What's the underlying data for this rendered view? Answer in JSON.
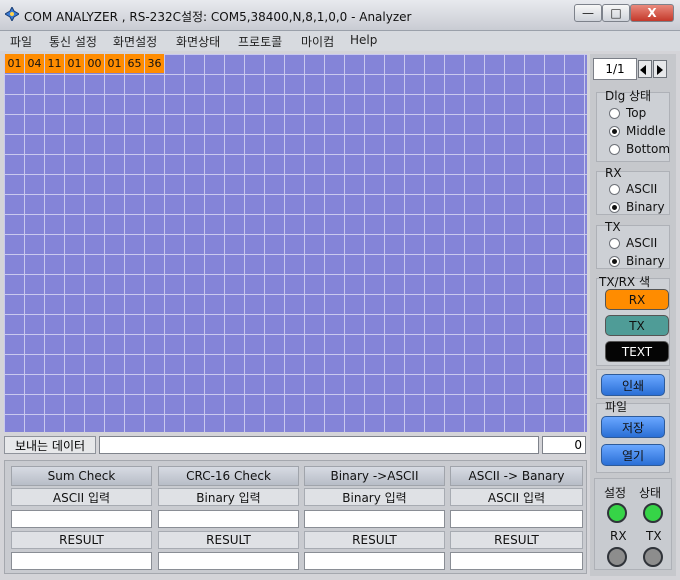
{
  "window": {
    "title": "COM ANALYZER , RS-232C설정: COM5,38400,N,8,1,0,0  - Analyzer",
    "buttons": {
      "minimize": "—",
      "maximize": "□",
      "close": "X"
    }
  },
  "menu": [
    "파일",
    "통신 설정",
    "화면설정",
    "화면상태",
    "프로토콜",
    "마이컴",
    "Help"
  ],
  "grid": {
    "cells": [
      "01",
      "04",
      "11",
      "01",
      "00",
      "01",
      "65",
      "36"
    ]
  },
  "send": {
    "label": "보내는 데이터",
    "value": "",
    "count": "0"
  },
  "tools": {
    "checks": [
      "Sum Check",
      "CRC-16 Check",
      "Binary ->ASCII",
      "ASCII -> Banary"
    ],
    "input_labels": [
      "ASCII 입력",
      "Binary 입력",
      "Binary 입력",
      "ASCII 입력"
    ],
    "results": [
      "RESULT",
      "RESULT",
      "RESULT",
      "RESULT"
    ]
  },
  "right": {
    "page": "1/1",
    "dlg": {
      "title": "Dlg 상태",
      "options": [
        "Top",
        "Middle",
        "Bottom"
      ],
      "selected": "Middle"
    },
    "rx": {
      "title": "RX",
      "options": [
        "ASCII",
        "Binary"
      ],
      "selected": "Binary"
    },
    "tx": {
      "title": "TX",
      "options": [
        "ASCII",
        "Binary"
      ],
      "selected": "Binary"
    },
    "color_title": "TX/RX 색",
    "color_buttons": [
      {
        "label": "RX",
        "color": "#ff8c00"
      },
      {
        "label": "TX",
        "color": "#4f9c97"
      },
      {
        "label": "TEXT",
        "color": "#050505"
      }
    ],
    "print": "인쇄",
    "file_title": "파일",
    "save": "저장",
    "open": "열기",
    "status": {
      "setting": "설정",
      "state": "상태",
      "rx": "RX",
      "tx": "TX"
    }
  },
  "colors": {
    "grid_bg": "#8484d8",
    "grid_line": "#c9c9ee",
    "led_on": "#36d447",
    "led_off": "#8d8d8d"
  }
}
